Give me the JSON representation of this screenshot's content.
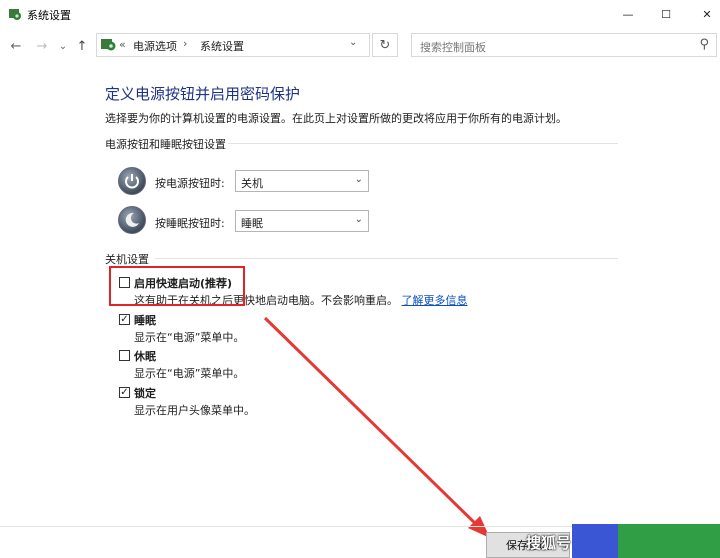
{
  "window": {
    "title": "系统设置",
    "minimize_glyph": "—",
    "maximize_glyph": "☐",
    "close_glyph": "✕"
  },
  "nav": {
    "back_glyph": "←",
    "forward_glyph": "→",
    "recent_glyph": "⌄",
    "up_glyph": "↑",
    "refresh_glyph": "↻",
    "dropdown_glyph": "⌄"
  },
  "breadcrumb": {
    "sep": "«",
    "parent": "电源选项",
    "arrow": "›",
    "current": "系统设置"
  },
  "search": {
    "placeholder": "搜索控制面板",
    "icon": "⚲"
  },
  "page": {
    "title": "定义电源按钮并启用密码保护",
    "description": "选择要为你的计算机设置的电源设置。在此页上对设置所做的更改将应用于你所有的电源计划。"
  },
  "buttons_section": {
    "heading": "电源按钮和睡眠按钮设置",
    "power_label": "按电源按钮时:",
    "power_value": "关机",
    "sleep_label": "按睡眠按钮时:",
    "sleep_value": "睡眠",
    "arrow": "⌄"
  },
  "shutdown_section": {
    "heading": "关机设置",
    "items": [
      {
        "label": "启用快速启动(推荐)",
        "desc": "这有助于在关机之后更快地启动电脑。不会影响重启。",
        "link": "了解更多信息",
        "checked": false
      },
      {
        "label": "睡眠",
        "desc": "显示在“电源”菜单中。",
        "checked": true
      },
      {
        "label": "休眠",
        "desc": "显示在“电源”菜单中。",
        "checked": false
      },
      {
        "label": "锁定",
        "desc": "显示在用户头像菜单中。",
        "checked": true
      }
    ],
    "check_glyph": "✓"
  },
  "footer": {
    "save_label": "保存修改"
  },
  "watermark": "搜狐号",
  "colors": {
    "title_blue": "#1e3287",
    "link_blue": "#0a4fc2",
    "highlight_red": "#e02424",
    "arrow_red": "#e53935"
  }
}
